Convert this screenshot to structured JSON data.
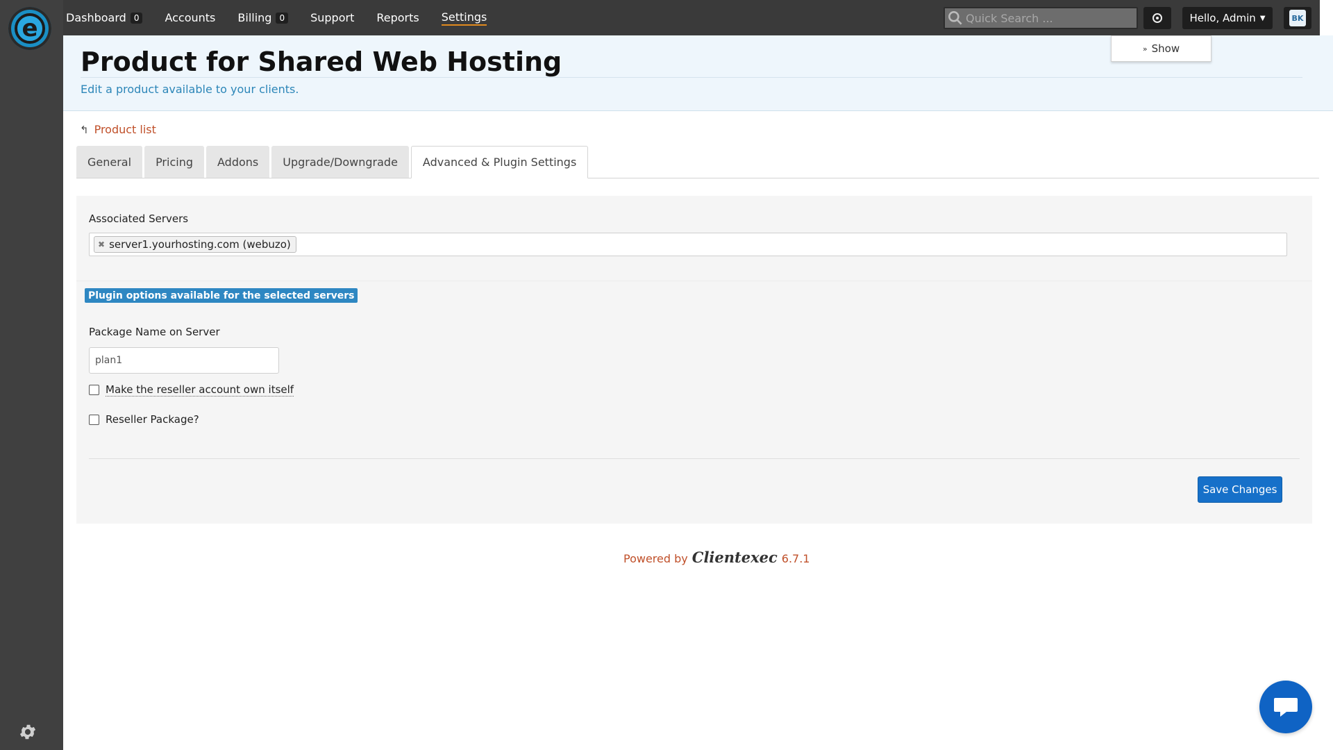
{
  "nav": {
    "items": [
      {
        "label": "Dashboard",
        "badge": "0"
      },
      {
        "label": "Accounts"
      },
      {
        "label": "Billing",
        "badge": "0"
      },
      {
        "label": "Support"
      },
      {
        "label": "Reports"
      },
      {
        "label": "Settings",
        "active": true
      }
    ],
    "search_placeholder": "Quick Search ...",
    "greeting": "Hello, Admin",
    "avatar_initials": "BK"
  },
  "header": {
    "title": "Product for Shared Web Hosting",
    "subtitle": "Edit a product available to your clients.",
    "show_label": "Show"
  },
  "breadcrumb": {
    "back_label": "Product list"
  },
  "tabs": [
    {
      "label": "General"
    },
    {
      "label": "Pricing"
    },
    {
      "label": "Addons"
    },
    {
      "label": "Upgrade/Downgrade"
    },
    {
      "label": "Advanced & Plugin Settings",
      "active": true
    }
  ],
  "form": {
    "associated_servers_label": "Associated Servers",
    "associated_servers": [
      "server1.yourhosting.com (webuzo)"
    ],
    "plugin_options_label": "Plugin options available for the selected servers",
    "package_name_label": "Package Name on Server",
    "package_name_value": "plan1",
    "checkbox_reseller_own": {
      "label": "Make the reseller account own itself",
      "checked": false
    },
    "checkbox_reseller_package": {
      "label": "Reseller Package?",
      "checked": false
    },
    "save_label": "Save Changes"
  },
  "footer": {
    "powered_by": "Powered by",
    "brand": "Clientexec",
    "version": "6.7.1"
  },
  "colors": {
    "accent_orange": "#e08a1e",
    "link_red": "#c0502a",
    "primary_blue": "#1670c9",
    "header_bg": "#eef6fc"
  }
}
